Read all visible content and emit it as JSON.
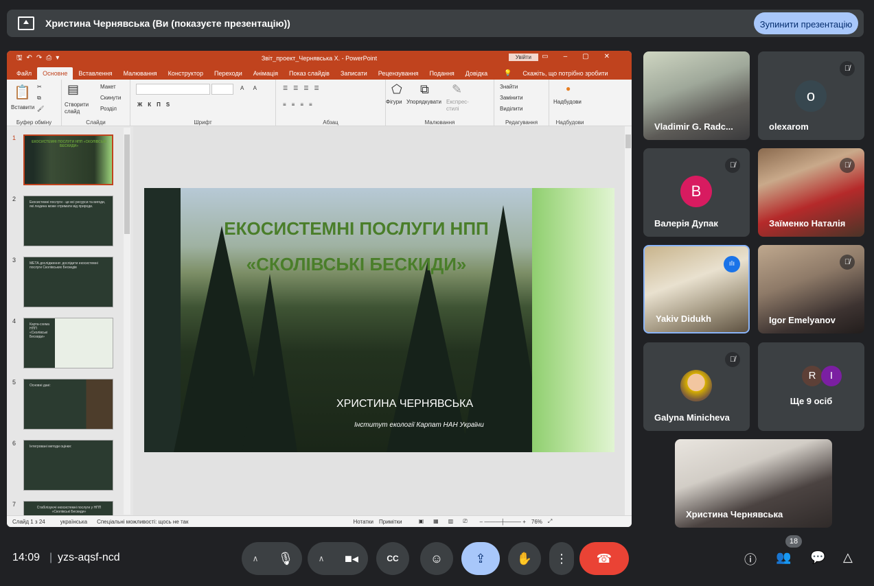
{
  "topbar": {
    "title": "Христина Чернявська (Ви (показуєте презентацію))",
    "stop_button": "Зупинити презентацію"
  },
  "ppt": {
    "doc_title": "Звіт_проект_Чернявська Х.  -  PowerPoint",
    "login_button": "Увійти",
    "tabs": [
      "Файл",
      "Основне",
      "Вставлення",
      "Малювання",
      "Конструктор",
      "Переходи",
      "Анімація",
      "Показ слайдів",
      "Записати",
      "Рецензування",
      "Подання",
      "Довідка"
    ],
    "tell_me": "Скажіть, що потрібно зробити",
    "ribbon": {
      "paste": "Вставити",
      "clipboard_group": "Буфер обміну",
      "new_slide": "Створити слайд",
      "layout": "Макет",
      "reset": "Скинути",
      "section": "Розділ",
      "slides_group": "Слайди",
      "font_group": "Шрифт",
      "paragraph_group": "Абзац",
      "shapes": "Фігури",
      "arrange": "Упорядкувати",
      "quick_styles": "Експрес-стилі",
      "drawing_group": "Малювання",
      "find": "Знайти",
      "replace": "Замінити",
      "select": "Виділити",
      "editing_group": "Редагування",
      "addins": "Надбудови",
      "addins_group": "Надбудови"
    },
    "thumbnails": [
      {
        "num": "1",
        "text": "ЕКОСИСТЕМНІ ПОСЛУГИ НПП «СКОЛІВСЬКІ БЕСКИДИ»"
      },
      {
        "num": "2",
        "text": "Екосистемні послуги - це всі ресурси та вигоди, які людина може отримати від природи."
      },
      {
        "num": "3",
        "text": "МЕТА дослідження: дослідити екосистемні послуги Сколівських Бескидів"
      },
      {
        "num": "4",
        "text": "Карта-схема НПП «Сколівські Бескиди»"
      },
      {
        "num": "5",
        "text": "Основні дані:"
      },
      {
        "num": "6",
        "text": "Інтегровані методи оцінки:"
      },
      {
        "num": "7",
        "text": "Стабілізуючі екосистемні послуги у НПП «Сколівські Бескиди»"
      }
    ],
    "slide": {
      "title_line1": "ЕКОСИСТЕМНІ ПОСЛУГИ НПП",
      "title_line2": "«СКОЛІВСЬКІ БЕСКИДИ»",
      "author": "ХРИСТИНА ЧЕРНЯВСЬКА",
      "institute": "Інститут екології Карпат НАН України"
    },
    "status": {
      "slide_info": "Слайд 1 з 24",
      "language": "українська",
      "accessibility": "Спеціальні можливості: щось не так",
      "notes": "Нотатки",
      "comments": "Примітки",
      "zoom": "76%"
    }
  },
  "participants": [
    {
      "name": "Vladimir G. Radc...",
      "muted": false
    },
    {
      "name": "olexarom",
      "avatar": "o",
      "avatar_color": "#37474f",
      "muted": true
    },
    {
      "name": "Валерія Дупак",
      "avatar": "В",
      "avatar_color": "#d81b60",
      "muted": true
    },
    {
      "name": "Заїменко Наталія",
      "muted": true
    },
    {
      "name": "Yakiv Didukh",
      "muted": false,
      "speaking": true
    },
    {
      "name": "Igor Emelyanov",
      "muted": true
    },
    {
      "name": "Galyna Minicheva",
      "muted": true
    },
    {
      "name": "Ще 9 осіб",
      "avatars": [
        "R",
        "I"
      ]
    }
  ],
  "self": {
    "name": "Христина Чернявська"
  },
  "bottom": {
    "time": "14:09",
    "separator": "|",
    "meeting_code": "yzs-aqsf-ncd",
    "people_count": "18"
  },
  "colors": {
    "ppt_accent": "#c0431e",
    "present_button": "#a8c7fa",
    "end_call": "#ea4335",
    "meet_bg": "#202124"
  }
}
